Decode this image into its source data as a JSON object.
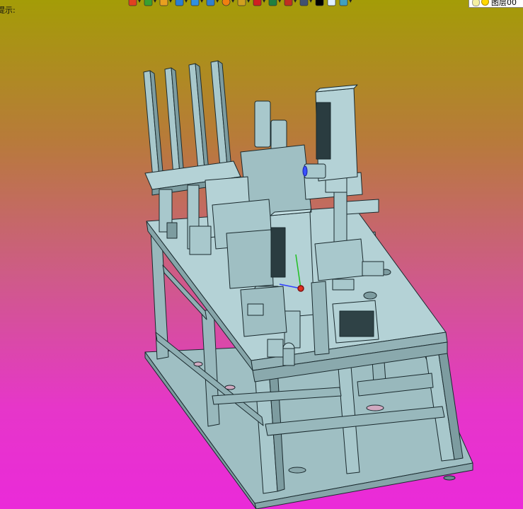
{
  "status": {
    "hint_text": "提示:"
  },
  "toolbar": {
    "buttons": [
      {
        "icon": "import-icon",
        "color": "#e04020"
      },
      {
        "icon": "curve-icon",
        "color": "#3aa030"
      },
      {
        "icon": "sketch-icon",
        "color": "#e8a020"
      },
      {
        "icon": "solid-box-icon",
        "color": "#2a7fd4"
      },
      {
        "icon": "surface-icon",
        "color": "#3090e0"
      },
      {
        "icon": "face-icon",
        "color": "#3080d0"
      },
      {
        "icon": "render-icon",
        "color": "#f08010"
      },
      {
        "icon": "view-icon",
        "color": "#d0a020"
      },
      {
        "icon": "move-icon",
        "color": "#d02020"
      },
      {
        "icon": "measure-icon",
        "color": "#208040"
      },
      {
        "icon": "snap-icon",
        "color": "#c03020"
      },
      {
        "icon": "display-icon",
        "color": "#405070"
      },
      {
        "icon": "color-swatch-icon",
        "color": "#000000"
      },
      {
        "icon": "blank-sheet-icon",
        "color": "#e0f0ff"
      },
      {
        "icon": "layers-icon",
        "color": "#40a0c0"
      }
    ]
  },
  "layer_selector": {
    "value": "图层00"
  },
  "viewport": {
    "model_color": "#a8c8cc",
    "edge_color": "#1a2a2e",
    "background_top": "#a49c07",
    "background_bottom": "#ea2ad9"
  }
}
